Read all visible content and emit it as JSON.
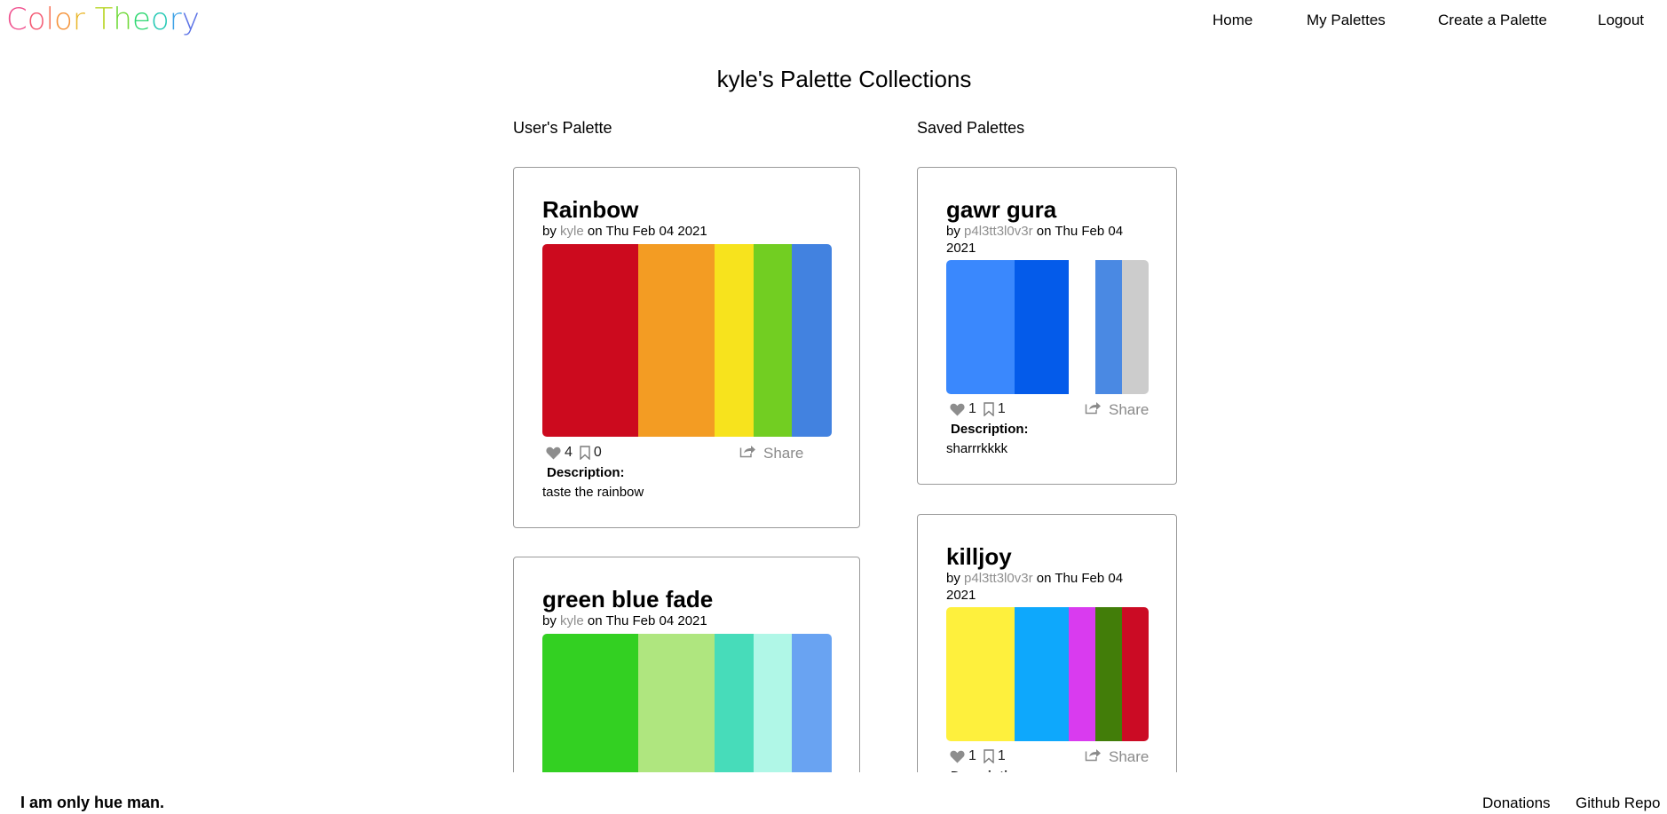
{
  "brand": {
    "logo_letters": [
      {
        "ch": "C",
        "color": "#f0528f"
      },
      {
        "ch": "o",
        "color": "#f45a73"
      },
      {
        "ch": "l",
        "color": "#f76f55"
      },
      {
        "ch": "o",
        "color": "#f5943c"
      },
      {
        "ch": "r",
        "color": "#e9b72c"
      },
      {
        "ch": " ",
        "color": "#ffffff"
      },
      {
        "ch": "T",
        "color": "#b9d628"
      },
      {
        "ch": "h",
        "color": "#6ed936"
      },
      {
        "ch": "e",
        "color": "#2fd872"
      },
      {
        "ch": "o",
        "color": "#26c9b5"
      },
      {
        "ch": "r",
        "color": "#3ea2e6"
      },
      {
        "ch": "y",
        "color": "#5b72e6"
      }
    ]
  },
  "nav": {
    "home": "Home",
    "my_palettes": "My Palettes",
    "create": "Create a Palette",
    "logout": "Logout"
  },
  "page": {
    "title": "kyle's Palette Collections",
    "user_col_title": "User's Palette",
    "saved_col_title": "Saved Palettes"
  },
  "common": {
    "by": "by",
    "on": "on",
    "share": "Share",
    "description_label": "Description:"
  },
  "user_palettes": [
    {
      "title": "Rainbow",
      "author": "kyle",
      "date": "Thu Feb 04 2021",
      "likes": "4",
      "saves": "0",
      "description": "taste the rainbow",
      "colors": [
        "#cc0a1e",
        "#f39c23",
        "#f7e31d",
        "#72ce22",
        "#4282e0"
      ]
    },
    {
      "title": "green blue fade",
      "author": "kyle",
      "date": "Thu Feb 04 2021",
      "likes": "",
      "saves": "",
      "description": "",
      "colors": [
        "#33d022",
        "#afe67f",
        "#47dcba",
        "#b0f7e7",
        "#69a3f2"
      ]
    }
  ],
  "saved_palettes": [
    {
      "title": "gawr gura",
      "author": "p4l3tt3l0v3r",
      "date": "Thu Feb 04 2021",
      "likes": "1",
      "saves": "1",
      "description": "sharrrkkkk",
      "colors": [
        "#3a88fd",
        "#045bea",
        "#ffffff",
        "#4a89e3",
        "#cccccc"
      ]
    },
    {
      "title": "killjoy",
      "author": "p4l3tt3l0v3r",
      "date": "Thu Feb 04 2021",
      "likes": "1",
      "saves": "1",
      "description": "",
      "colors": [
        "#fef03d",
        "#0ea8fc",
        "#d93bef",
        "#427d09",
        "#cb0b24"
      ]
    }
  ],
  "footer": {
    "tagline": "I am only hue man.",
    "donations": "Donations",
    "github": "Github Repo"
  }
}
